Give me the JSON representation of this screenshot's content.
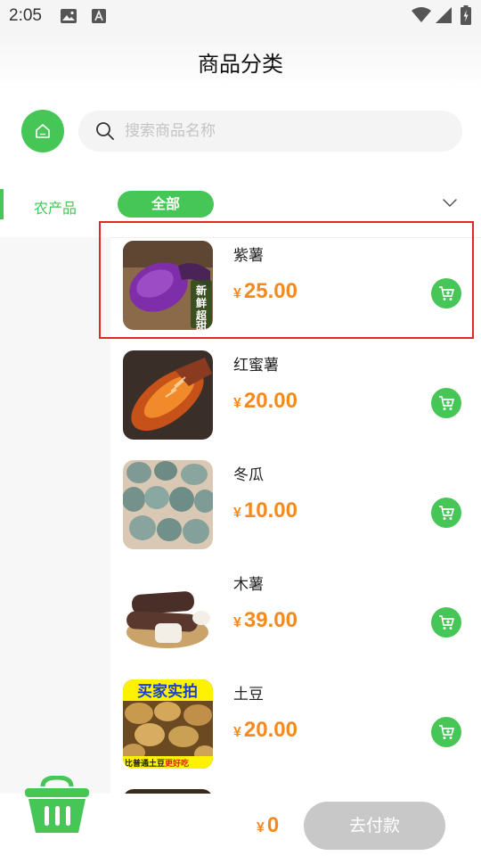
{
  "status_bar": {
    "time": "2:05",
    "icons": [
      "image-icon",
      "a-icon",
      "wifi-icon",
      "signal-icon",
      "battery-icon"
    ]
  },
  "header": {
    "title": "商品分类"
  },
  "search": {
    "placeholder": "搜索商品名称",
    "value": ""
  },
  "sidebar": {
    "items": [
      {
        "label": "农产品",
        "selected": true
      }
    ]
  },
  "tabs": {
    "items": [
      {
        "label": "全部",
        "selected": true
      }
    ]
  },
  "products": [
    {
      "name": "紫薯",
      "currency": "¥",
      "price": "25.00",
      "image": "purple-sweet-potato-photo",
      "highlighted": true
    },
    {
      "name": "红蜜薯",
      "currency": "¥",
      "price": "20.00",
      "image": "red-sweet-potato-photo"
    },
    {
      "name": "冬瓜",
      "currency": "¥",
      "price": "10.00",
      "image": "winter-melon-photo"
    },
    {
      "name": "木薯",
      "currency": "¥",
      "price": "39.00",
      "image": "cassava-photo"
    },
    {
      "name": "土豆",
      "currency": "¥",
      "price": "20.00",
      "image": "potato-photo",
      "image_text": [
        "买家实拍",
        "比普通土豆",
        "更好吃"
      ]
    }
  ],
  "bottom": {
    "currency": "¥",
    "total": "0",
    "pay_label": "去付款"
  },
  "colors": {
    "accent": "#45c657",
    "price": "#f48a1d",
    "highlight": "#e02828",
    "disabled": "#c8c8c8"
  }
}
